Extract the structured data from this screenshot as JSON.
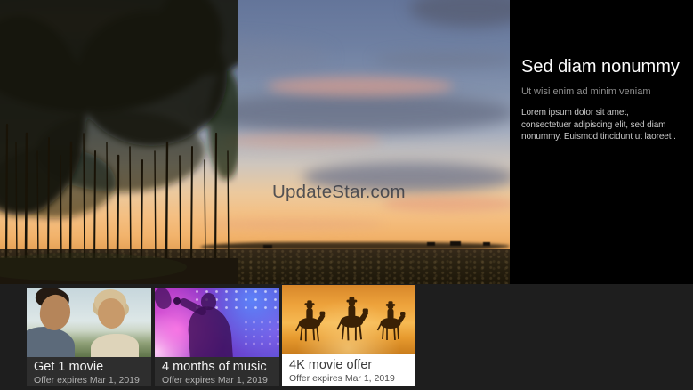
{
  "hero": {
    "watermark": "UpdateStar.com",
    "description": "sunset-landscape-with-poplar-grove-and-field"
  },
  "info_panel": {
    "title": "Sed diam nonummy",
    "subtitle": "Ut wisi enim ad minim veniam",
    "body": "Lorem ipsum dolor sit amet, consectetuer adipiscing elit, sed diam nonummy. Euismod tincidunt ut laoreet ."
  },
  "cards": [
    {
      "title": "Get 1 movie",
      "subtitle": "Offer expires Mar 1, 2019",
      "image": "father-and-son",
      "selected": false
    },
    {
      "title": "4 months of music",
      "subtitle": "Offer expires Mar 1, 2019",
      "image": "concert-singer",
      "selected": false
    },
    {
      "title": "4K movie offer",
      "subtitle": "Offer expires Mar 1, 2019",
      "image": "three-horsemen-riding",
      "selected": true
    }
  ],
  "colors": {
    "panel_background": "#000000",
    "bottom_bar_background": "#1e1e1e",
    "card_label_background": "#2e2e2e",
    "selected_card_label_background": "#ffffff",
    "title_text": "#fdfdfd",
    "muted_text": "#8d8d8d"
  }
}
